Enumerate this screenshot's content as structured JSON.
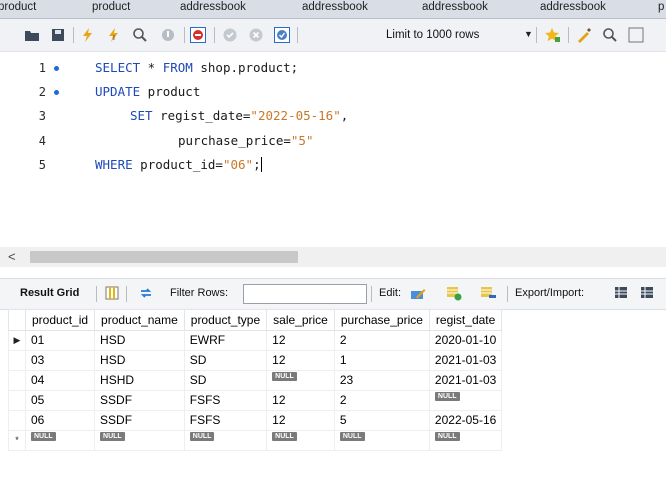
{
  "tabs": [
    "product",
    "product",
    "addressbook",
    "addressbook",
    "addressbook",
    "addressbook",
    "p"
  ],
  "toolbar": {
    "limit_label": "Limit to 1000 rows",
    "icons": [
      "folder-icon",
      "save-icon",
      "execute-icon",
      "execute-current-icon",
      "explain-icon",
      "stop-icon",
      "toggle-error-icon",
      "commit-icon",
      "rollback-icon",
      "autocommit-icon",
      "dropdown-icon",
      "bookmark-icon",
      "beautify-icon",
      "find-icon",
      "invisible-icon"
    ]
  },
  "editor": {
    "lines": [
      {
        "num": "1",
        "marker": true
      },
      {
        "num": "2",
        "marker": true
      },
      {
        "num": "3",
        "marker": false
      },
      {
        "num": "4",
        "marker": false
      },
      {
        "num": "5",
        "marker": false
      }
    ],
    "code": {
      "l1_kw": "SELECT",
      "l1_rest": " * ",
      "l1_kw2": "FROM",
      "l1_tail": " shop.product;",
      "l2_kw": "UPDATE",
      "l2_rest": " product",
      "l3_kw": "SET",
      "l3_rest": " regist_date=",
      "l3_str": "\"2022-05-16\"",
      "l3_tail": ",",
      "l4_rest": "purchase_price=",
      "l4_str": "\"5\"",
      "l5_kw": "WHERE",
      "l5_rest": " product_id=",
      "l5_str": "\"06\"",
      "l5_tail": ";"
    }
  },
  "result": {
    "result_grid_label": "Result Grid",
    "filter_label": "Filter Rows:",
    "edit_label": "Edit:",
    "export_label": "Export/Import:",
    "columns": [
      "product_id",
      "product_name",
      "product_type",
      "sale_price",
      "purchase_price",
      "regist_date"
    ],
    "rows": [
      {
        "marker": "▶",
        "cells": [
          "01",
          "HSD",
          "EWRF",
          "12",
          "2",
          "2020-01-10"
        ]
      },
      {
        "marker": "",
        "cells": [
          "03",
          "HSD",
          "SD",
          "12",
          "1",
          "2021-01-03"
        ]
      },
      {
        "marker": "",
        "cells": [
          "04",
          "HSHD",
          "SD",
          "NULL",
          "23",
          "2021-01-03"
        ]
      },
      {
        "marker": "",
        "cells": [
          "05",
          "SSDF",
          "FSFS",
          "12",
          "2",
          "NULL"
        ]
      },
      {
        "marker": "",
        "cells": [
          "06",
          "SSDF",
          "FSFS",
          "12",
          "5",
          "2022-05-16"
        ]
      },
      {
        "marker": "*",
        "cells": [
          "NULL",
          "NULL",
          "NULL",
          "NULL",
          "NULL",
          "NULL"
        ]
      }
    ],
    "null_label": "NULL"
  }
}
